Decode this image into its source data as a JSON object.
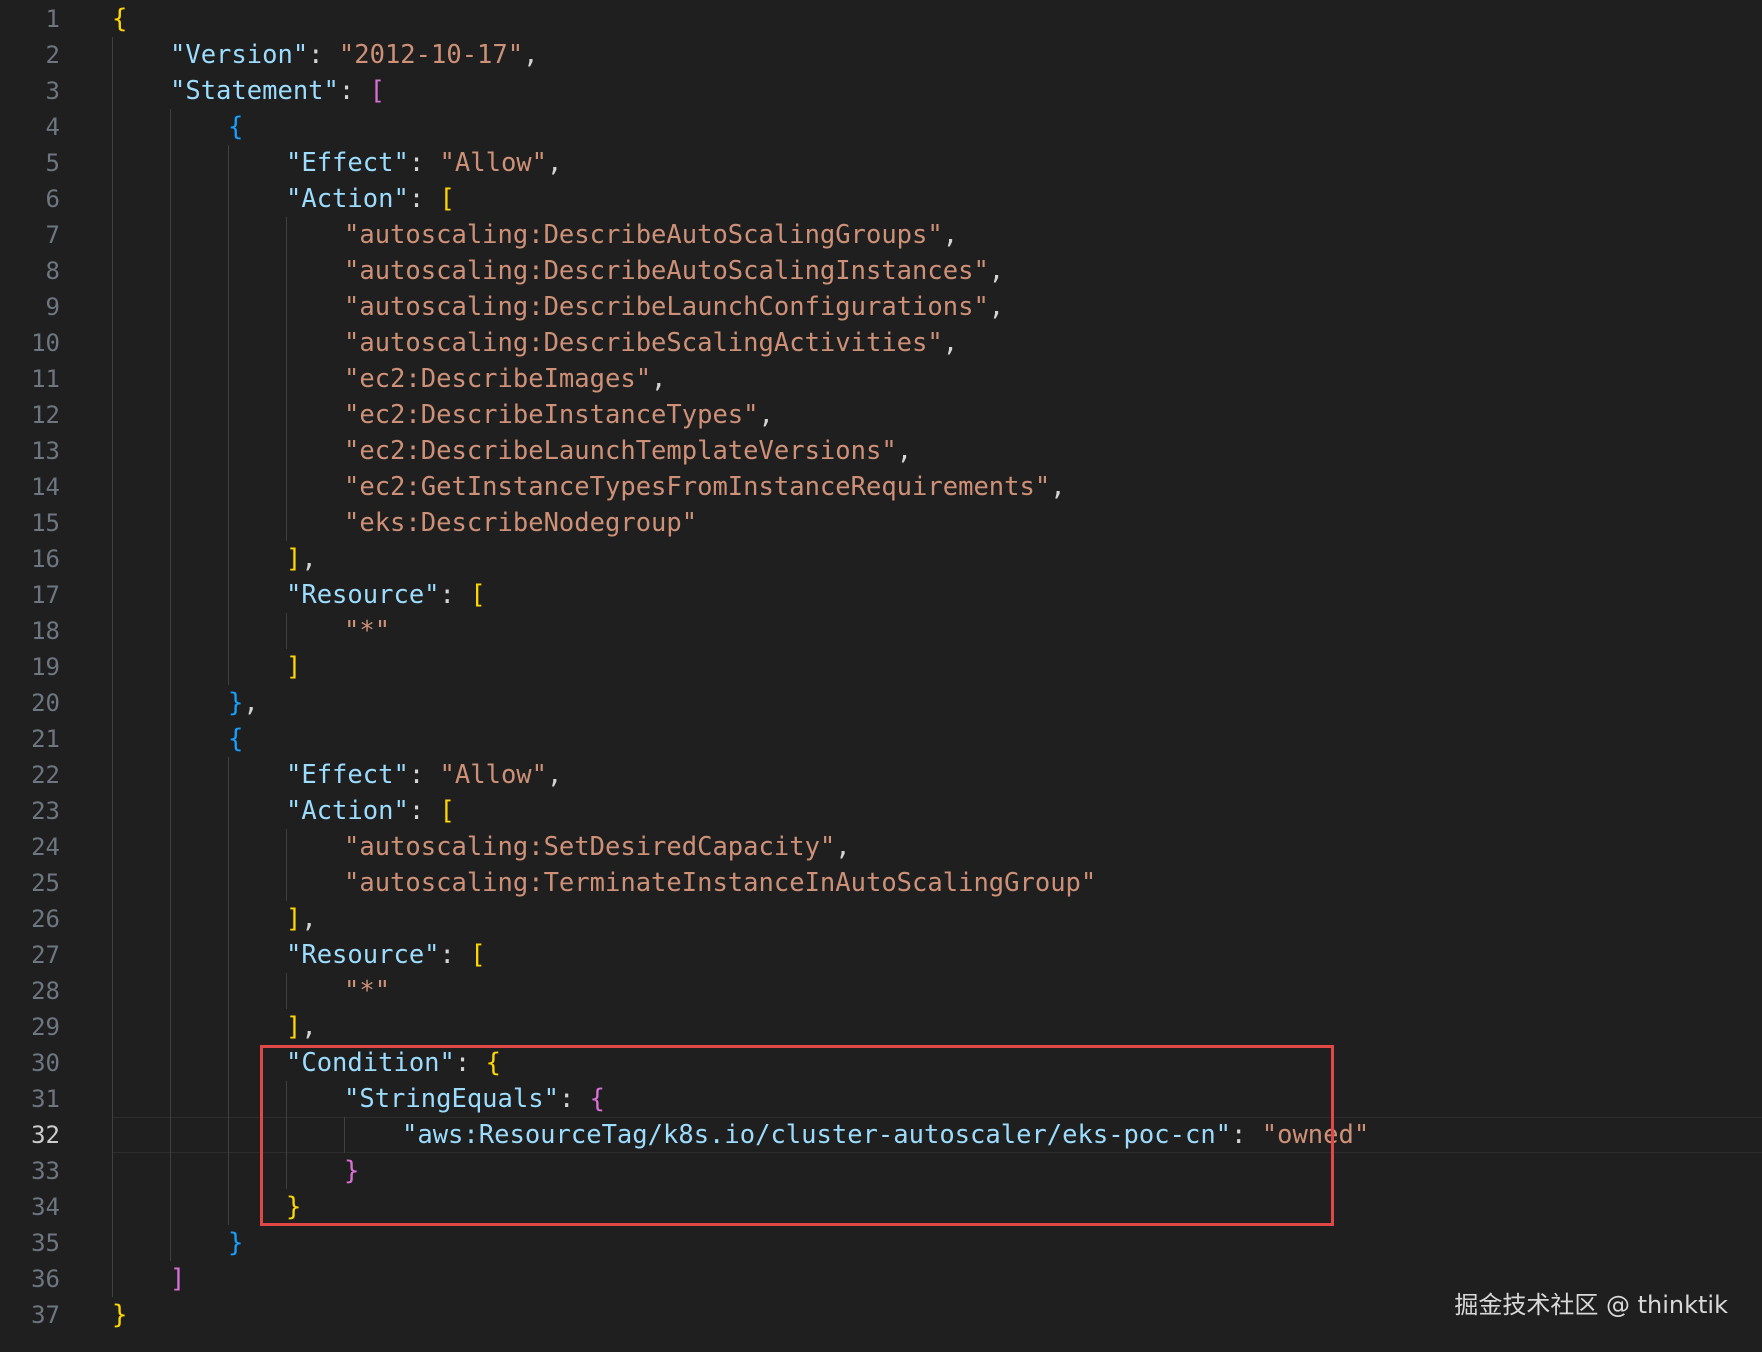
{
  "editor": {
    "active_line": 32,
    "lines": [
      {
        "n": "1",
        "indent": 0,
        "t": [
          [
            "{",
            "b1"
          ]
        ]
      },
      {
        "n": "2",
        "indent": 1,
        "t": [
          [
            "\"Version\"",
            "key"
          ],
          [
            ": ",
            "pun"
          ],
          [
            "\"2012-10-17\"",
            "str"
          ],
          [
            ",",
            "pun"
          ]
        ]
      },
      {
        "n": "3",
        "indent": 1,
        "t": [
          [
            "\"Statement\"",
            "key"
          ],
          [
            ": ",
            "pun"
          ],
          [
            "[",
            "b2"
          ]
        ]
      },
      {
        "n": "4",
        "indent": 2,
        "t": [
          [
            "{",
            "b3"
          ]
        ]
      },
      {
        "n": "5",
        "indent": 3,
        "t": [
          [
            "\"Effect\"",
            "key"
          ],
          [
            ": ",
            "pun"
          ],
          [
            "\"Allow\"",
            "str"
          ],
          [
            ",",
            "pun"
          ]
        ]
      },
      {
        "n": "6",
        "indent": 3,
        "t": [
          [
            "\"Action\"",
            "key"
          ],
          [
            ": ",
            "pun"
          ],
          [
            "[",
            "b1"
          ]
        ]
      },
      {
        "n": "7",
        "indent": 4,
        "t": [
          [
            "\"autoscaling:DescribeAutoScalingGroups\"",
            "str"
          ],
          [
            ",",
            "pun"
          ]
        ]
      },
      {
        "n": "8",
        "indent": 4,
        "t": [
          [
            "\"autoscaling:DescribeAutoScalingInstances\"",
            "str"
          ],
          [
            ",",
            "pun"
          ]
        ]
      },
      {
        "n": "9",
        "indent": 4,
        "t": [
          [
            "\"autoscaling:DescribeLaunchConfigurations\"",
            "str"
          ],
          [
            ",",
            "pun"
          ]
        ]
      },
      {
        "n": "10",
        "indent": 4,
        "t": [
          [
            "\"autoscaling:DescribeScalingActivities\"",
            "str"
          ],
          [
            ",",
            "pun"
          ]
        ]
      },
      {
        "n": "11",
        "indent": 4,
        "t": [
          [
            "\"ec2:DescribeImages\"",
            "str"
          ],
          [
            ",",
            "pun"
          ]
        ]
      },
      {
        "n": "12",
        "indent": 4,
        "t": [
          [
            "\"ec2:DescribeInstanceTypes\"",
            "str"
          ],
          [
            ",",
            "pun"
          ]
        ]
      },
      {
        "n": "13",
        "indent": 4,
        "t": [
          [
            "\"ec2:DescribeLaunchTemplateVersions\"",
            "str"
          ],
          [
            ",",
            "pun"
          ]
        ]
      },
      {
        "n": "14",
        "indent": 4,
        "t": [
          [
            "\"ec2:GetInstanceTypesFromInstanceRequirements\"",
            "str"
          ],
          [
            ",",
            "pun"
          ]
        ]
      },
      {
        "n": "15",
        "indent": 4,
        "t": [
          [
            "\"eks:DescribeNodegroup\"",
            "str"
          ]
        ]
      },
      {
        "n": "16",
        "indent": 3,
        "t": [
          [
            "]",
            "b1"
          ],
          [
            ",",
            "pun"
          ]
        ]
      },
      {
        "n": "17",
        "indent": 3,
        "t": [
          [
            "\"Resource\"",
            "key"
          ],
          [
            ": ",
            "pun"
          ],
          [
            "[",
            "b1"
          ]
        ]
      },
      {
        "n": "18",
        "indent": 4,
        "t": [
          [
            "\"*\"",
            "str"
          ]
        ]
      },
      {
        "n": "19",
        "indent": 3,
        "t": [
          [
            "]",
            "b1"
          ]
        ]
      },
      {
        "n": "20",
        "indent": 2,
        "t": [
          [
            "}",
            "b3"
          ],
          [
            ",",
            "pun"
          ]
        ]
      },
      {
        "n": "21",
        "indent": 2,
        "t": [
          [
            "{",
            "b3"
          ]
        ]
      },
      {
        "n": "22",
        "indent": 3,
        "t": [
          [
            "\"Effect\"",
            "key"
          ],
          [
            ": ",
            "pun"
          ],
          [
            "\"Allow\"",
            "str"
          ],
          [
            ",",
            "pun"
          ]
        ]
      },
      {
        "n": "23",
        "indent": 3,
        "t": [
          [
            "\"Action\"",
            "key"
          ],
          [
            ": ",
            "pun"
          ],
          [
            "[",
            "b1"
          ]
        ]
      },
      {
        "n": "24",
        "indent": 4,
        "t": [
          [
            "\"autoscaling:SetDesiredCapacity\"",
            "str"
          ],
          [
            ",",
            "pun"
          ]
        ]
      },
      {
        "n": "25",
        "indent": 4,
        "t": [
          [
            "\"autoscaling:TerminateInstanceInAutoScalingGroup\"",
            "str"
          ]
        ]
      },
      {
        "n": "26",
        "indent": 3,
        "t": [
          [
            "]",
            "b1"
          ],
          [
            ",",
            "pun"
          ]
        ]
      },
      {
        "n": "27",
        "indent": 3,
        "t": [
          [
            "\"Resource\"",
            "key"
          ],
          [
            ": ",
            "pun"
          ],
          [
            "[",
            "b1"
          ]
        ]
      },
      {
        "n": "28",
        "indent": 4,
        "t": [
          [
            "\"*\"",
            "str"
          ]
        ]
      },
      {
        "n": "29",
        "indent": 3,
        "t": [
          [
            "]",
            "b1"
          ],
          [
            ",",
            "pun"
          ]
        ]
      },
      {
        "n": "30",
        "indent": 3,
        "t": [
          [
            "\"Condition\"",
            "key"
          ],
          [
            ": ",
            "pun"
          ],
          [
            "{",
            "b1"
          ]
        ]
      },
      {
        "n": "31",
        "indent": 4,
        "t": [
          [
            "\"StringEquals\"",
            "key"
          ],
          [
            ": ",
            "pun"
          ],
          [
            "{",
            "b2"
          ]
        ]
      },
      {
        "n": "32",
        "indent": 5,
        "t": [
          [
            "\"aws:ResourceTag/k8s.io/cluster-autoscaler/eks-poc-cn\"",
            "key"
          ],
          [
            ": ",
            "pun"
          ],
          [
            "\"owned\"",
            "str"
          ]
        ]
      },
      {
        "n": "33",
        "indent": 4,
        "t": [
          [
            "}",
            "b2"
          ]
        ]
      },
      {
        "n": "34",
        "indent": 3,
        "t": [
          [
            "}",
            "b1"
          ]
        ]
      },
      {
        "n": "35",
        "indent": 2,
        "t": [
          [
            "}",
            "b3"
          ]
        ]
      },
      {
        "n": "36",
        "indent": 1,
        "t": [
          [
            "]",
            "b2"
          ]
        ]
      },
      {
        "n": "37",
        "indent": 0,
        "t": [
          [
            "}",
            "b1"
          ]
        ]
      }
    ]
  },
  "colors": {
    "background": "#1f1f1f",
    "key": "#9cdcfe",
    "string": "#ce9178",
    "bracket_gold": "#ffd700",
    "bracket_orchid": "#da70d6",
    "bracket_blue": "#179fff",
    "highlight_box": "#e04848"
  },
  "watermark": {
    "text": "掘金技术社区 @ thinktik"
  }
}
